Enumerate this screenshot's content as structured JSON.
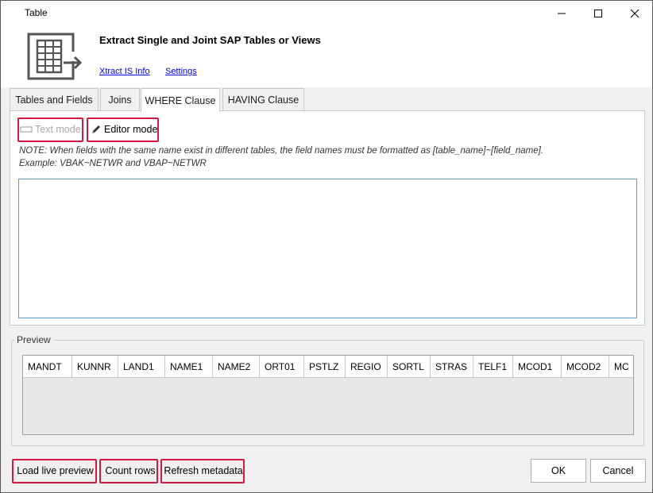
{
  "window": {
    "title": "Table"
  },
  "header": {
    "title": "Extract Single and Joint SAP Tables or Views",
    "links": {
      "info": "Xtract IS Info",
      "settings": "Settings"
    }
  },
  "tabs": [
    {
      "label": "Tables and Fields",
      "active": false
    },
    {
      "label": "Joins",
      "active": false
    },
    {
      "label": "WHERE Clause",
      "active": true
    },
    {
      "label": "HAVING Clause",
      "active": false
    }
  ],
  "where_clause": {
    "text_mode_label": "Text mode",
    "editor_mode_label": "Editor mode",
    "note_line1": "NOTE: When fields with the same name exist in different tables, the field names must be formatted as [table_name]~[field_name].",
    "note_line2": "Example: VBAK~NETWR and VBAP~NETWR",
    "editor_value": ""
  },
  "preview": {
    "legend": "Preview",
    "columns": [
      "MANDT",
      "KUNNR",
      "LAND1",
      "NAME1",
      "NAME2",
      "ORT01",
      "PSTLZ",
      "REGIO",
      "SORTL",
      "STRAS",
      "TELF1",
      "MCOD1",
      "MCOD2",
      "MC"
    ]
  },
  "footer": {
    "load_preview": "Load live preview",
    "count_rows": "Count rows",
    "refresh_metadata": "Refresh metadata",
    "ok": "OK",
    "cancel": "Cancel"
  },
  "colors": {
    "highlight": "#d6173f",
    "link": "#0000ee",
    "editor_border": "#5b9bd5"
  }
}
